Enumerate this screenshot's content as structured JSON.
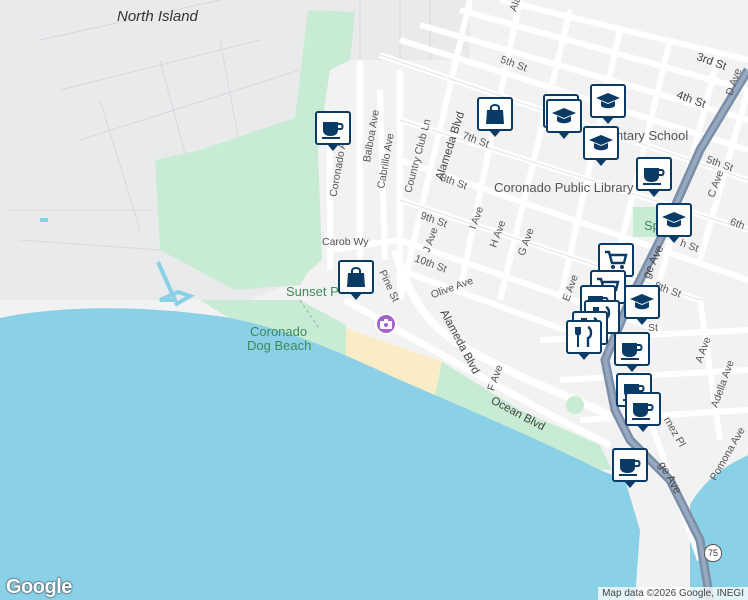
{
  "colors": {
    "water": "#8ad0e6",
    "land": "#f2f2f2",
    "park": "#c8ecd3",
    "beach": "#faedc5",
    "highway": "#7b8ea8",
    "pin_border": "#0a3a66",
    "photo_marker": "#a463c9"
  },
  "labels": {
    "north_island": "North Island",
    "third_st": "3rd St",
    "fourth_st": "4th St",
    "fifth_st_top": "5th St",
    "fifth_st_right": "5th St",
    "sixth_st": "6th",
    "seventh_st": "7th St",
    "eighth_st_left": "8th St",
    "eighth_st_right": "8th St",
    "ninth_st": "9th St",
    "tenth_st": "10th St",
    "elementary_school": "ntary School",
    "coronado_public_library": "Coronado Public Library",
    "spreckels_park": "Sp        ls Pk",
    "coronado_ave": "Coronado Ave",
    "balboa_ave": "Balboa Ave",
    "cabrillo_ave": "Cabrillo Ave",
    "country_club_ln": "Country Club Ln",
    "alameda_blvd_top": "Alameda Blvd",
    "alameda_blvd_bottom": "Alameda Blvd",
    "carob_wy": "Carob Wy",
    "sunset_park": "Sunset P",
    "pine_st": "Pine St",
    "olive_ave": "Olive Ave",
    "j_ave": "J Ave",
    "i_ave": "I Ave",
    "h_ave": "H Ave",
    "g_ave": "G Ave",
    "f_ave": "F Ave",
    "e_ave": "E Ave",
    "d_ave": "D Ave",
    "c_ave": "C Ave",
    "a_ave": "A Ave",
    "adella_ave": "Adella Ave",
    "pomona_ave": "Pomona Ave",
    "orange_ave_upper": "ge Ave",
    "orange_ave_lower": "ge Ave",
    "ocean_blvd": "Ocean Blvd",
    "coronado_dog_beach_line1": "Coronado",
    "coronado_dog_beach_line2": "Dog Beach",
    "st_fragment": "St",
    "th_st_fragment": "h St",
    "avenida_fragment": "rnez Pl",
    "top_ave_fragment": "Ala",
    "highway_75": "75",
    "google": "Google",
    "attribution": "Map data ©2026 Google, INEGI"
  },
  "markers": [
    {
      "name": "coffee-shop-marker",
      "icon": "coffee"
    },
    {
      "name": "shopping-bag-marker",
      "icon": "shopping-bag"
    },
    {
      "name": "school-marker",
      "icon": "school"
    },
    {
      "name": "school-marker",
      "icon": "school"
    },
    {
      "name": "school-marker",
      "icon": "school"
    },
    {
      "name": "coffee-shop-marker",
      "icon": "coffee"
    },
    {
      "name": "school-marker",
      "icon": "school"
    },
    {
      "name": "shopping-bag-marker",
      "icon": "shopping-bag"
    },
    {
      "name": "grocery-cart-marker",
      "icon": "cart"
    },
    {
      "name": "school-marker",
      "icon": "school"
    },
    {
      "name": "restaurant-marker",
      "icon": "restaurant"
    },
    {
      "name": "coffee-shop-marker",
      "icon": "coffee"
    },
    {
      "name": "coffee-shop-marker",
      "icon": "coffee"
    },
    {
      "name": "coffee-shop-marker",
      "icon": "coffee"
    },
    {
      "name": "coffee-shop-marker",
      "icon": "coffee"
    }
  ]
}
